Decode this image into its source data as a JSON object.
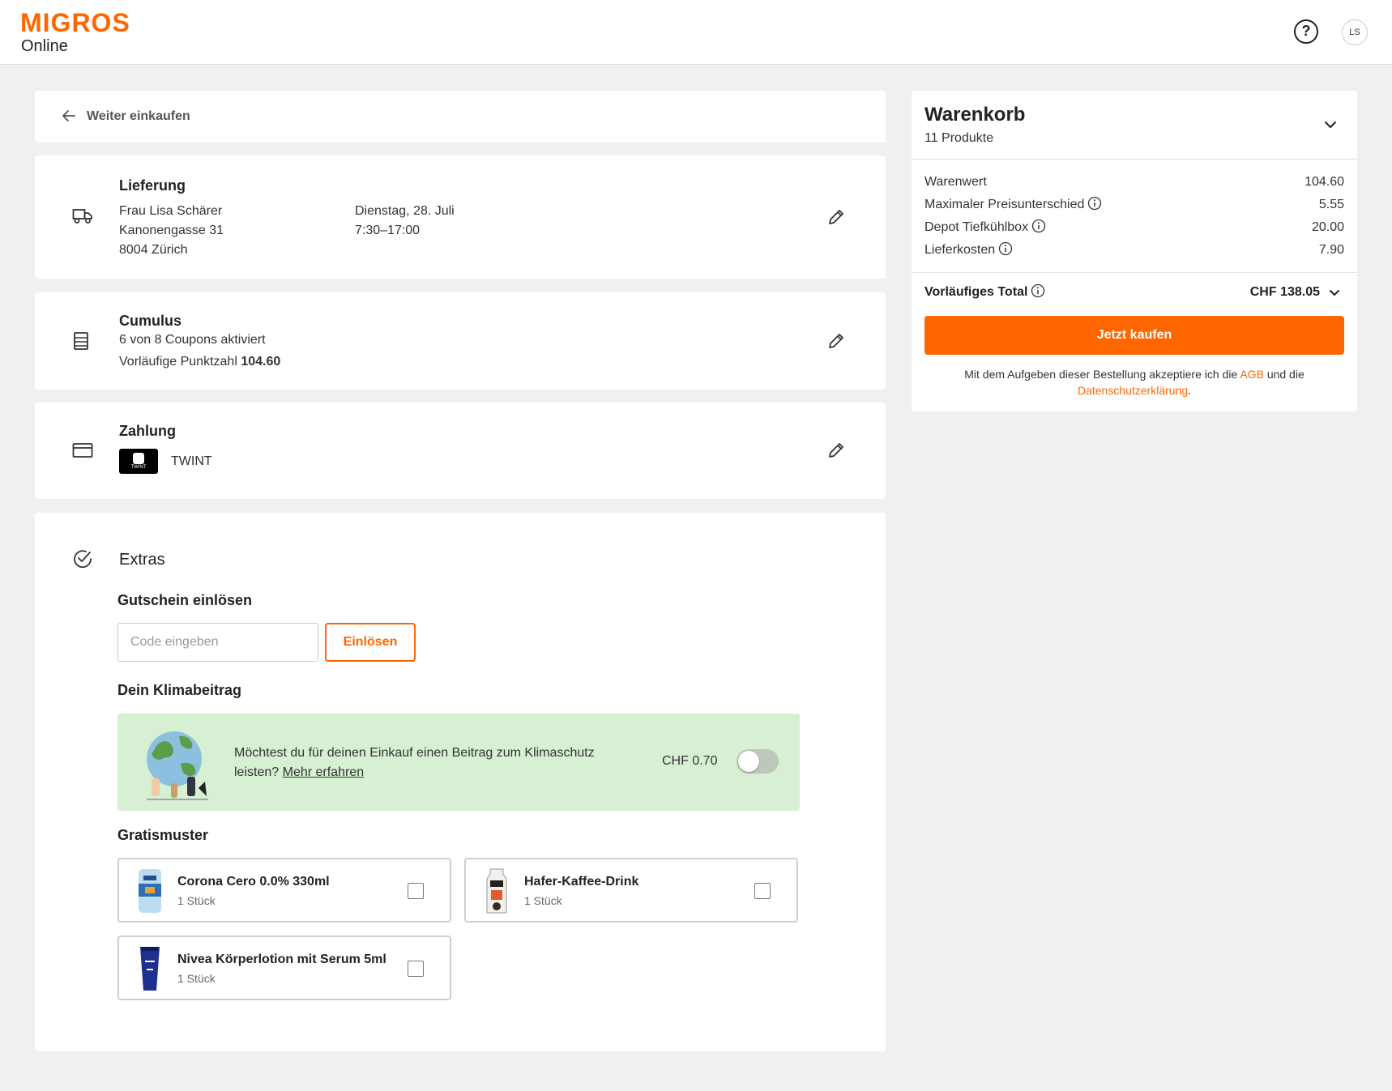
{
  "header": {
    "logo_main": "MIGROS",
    "logo_sub": "Online",
    "help_symbol": "?",
    "avatar_initials": "LS"
  },
  "back": {
    "label": "Weiter einkaufen"
  },
  "delivery": {
    "title": "Lieferung",
    "name": "Frau Lisa Schärer",
    "street": "Kanonengasse 31",
    "city": "8004 Zürich",
    "date": "Dienstag, 28. Juli",
    "time": "7:30–17:00"
  },
  "cumulus": {
    "title": "Cumulus",
    "coupons": "6 von 8 Coupons aktiviert",
    "points_label": "Vorläufige Punktzahl",
    "points_value": "104.60"
  },
  "payment": {
    "title": "Zahlung",
    "method": "TWINT",
    "logo_text": "TWINT"
  },
  "extras": {
    "title": "Extras",
    "voucher_heading": "Gutschein einlösen",
    "voucher_placeholder": "Code eingeben",
    "redeem_label": "Einlösen",
    "climate_heading": "Dein Klimabeitrag",
    "climate_text": "Möchtest du für deinen Einkauf einen Beitrag zum Klimaschutz leisten?",
    "climate_link": "Mehr erfahren",
    "climate_price": "CHF 0.70",
    "climate_enabled": false,
    "samples_heading": "Gratismuster",
    "samples": [
      {
        "name": "Corona Cero 0.0% 330ml",
        "qty": "1 Stück"
      },
      {
        "name": "Hafer-Kaffee-Drink",
        "qty": "1 Stück"
      },
      {
        "name": "Nivea Körperlotion mit Serum 5ml",
        "qty": "1 Stück"
      }
    ]
  },
  "cart": {
    "title": "Warenkorb",
    "count": "11 Produkte",
    "rows": [
      {
        "label": "Warenwert",
        "value": "104.60"
      },
      {
        "label": "Maximaler Preisunterschied",
        "value": "5.55"
      },
      {
        "label": "Depot Tiefkühlbox",
        "value": "20.00"
      },
      {
        "label": "Lieferkosten",
        "value": "7.90"
      }
    ],
    "total_label": "Vorläufiges Total",
    "total_value": "CHF 138.05",
    "buy_label": "Jetzt kaufen",
    "terms_prefix": "Mit dem Aufgeben dieser Bestellung akzeptiere ich die",
    "terms_agb": "AGB",
    "terms_mid": "und die",
    "terms_privacy": "Datenschutzerklärung",
    "terms_suffix": "."
  },
  "colors": {
    "accent": "#ff6600",
    "climate_bg": "#d7efd3",
    "page_bg": "#f0f0f0"
  }
}
